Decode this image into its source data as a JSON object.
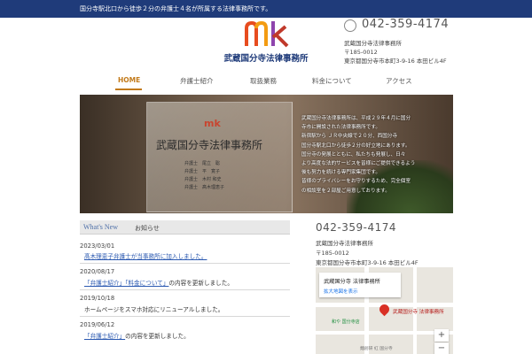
{
  "topbar": {
    "text": "国分寺駅北口から徒歩２分の弁護士４名が所属する法律事務所です。"
  },
  "logo": {
    "name": "武蔵国分寺法律事務所",
    "colors": [
      "#e74c1f",
      "#f39c12",
      "#8e44ad"
    ]
  },
  "header": {
    "phone": "042-359-4174",
    "office": "武蔵国分寺法律事務所",
    "zip": "〒185-0012",
    "address": "東京都国分寺市本町3-9-16 本田ビル4F"
  },
  "nav": [
    {
      "label": "HOME",
      "active": true
    },
    {
      "label": "弁護士紹介"
    },
    {
      "label": "取扱業務"
    },
    {
      "label": "料金について"
    },
    {
      "label": "アクセス"
    }
  ],
  "hero": {
    "sign_name": "武蔵国分寺法律事務所",
    "staff": [
      "弁護士　尾立　聡",
      "弁護士　平　寛子",
      "弁護士　木村 和史",
      "弁護士　髙木理恵子"
    ],
    "lines": [
      "武蔵国分寺法律事務所は、平成２９年４月に国分",
      "寺市に開設された法律事務所です。",
      "新宿駅から ＪＲ中央線で２０分、西国分寺",
      "国分寺駅北口から徒歩２分の好立地にあります。",
      "国分寺の発展とともに、私たちも発展し、日々",
      "より高度な法的サービスを皆様にご提供できるよう",
      "後も努力を続ける専門家集団です。",
      "皆様のプライバシーをお守りするため、完全個室",
      "の相談室を２部屋ご用意しております。"
    ]
  },
  "news": {
    "heading_en": "What's New",
    "heading_jp": "お知らせ",
    "items": [
      {
        "date": "2023/03/01",
        "link": "髙木理恵子弁護士が当事務所に加入しました。",
        "rest": ""
      },
      {
        "date": "2020/08/17",
        "link": "「弁護士紹介」「料金について」",
        "rest": "の内容を更新しました。"
      },
      {
        "date": "2019/10/18",
        "link": "",
        "rest": "ホームページをスマホ対応にリニューアルしました。"
      },
      {
        "date": "2019/06/12",
        "link": "「弁護士紹介」",
        "rest": "の内容を更新しました。"
      }
    ]
  },
  "side": {
    "phone": "042-359-4174",
    "office": "武蔵国分寺法律事務所",
    "zip": "〒185-0012",
    "address": "東京都国分寺市本町3-9-16 本田ビル4F"
  },
  "map": {
    "card_title": "武蔵国分寺 法律事務所",
    "card_link": "拡大地図を表示",
    "pin_label": "武蔵国分寺 法律事務所",
    "zoom_in": "+",
    "zoom_out": "−",
    "green_label": "和や 国分寺店",
    "small_label": "麺創研 紅 国分寺"
  }
}
